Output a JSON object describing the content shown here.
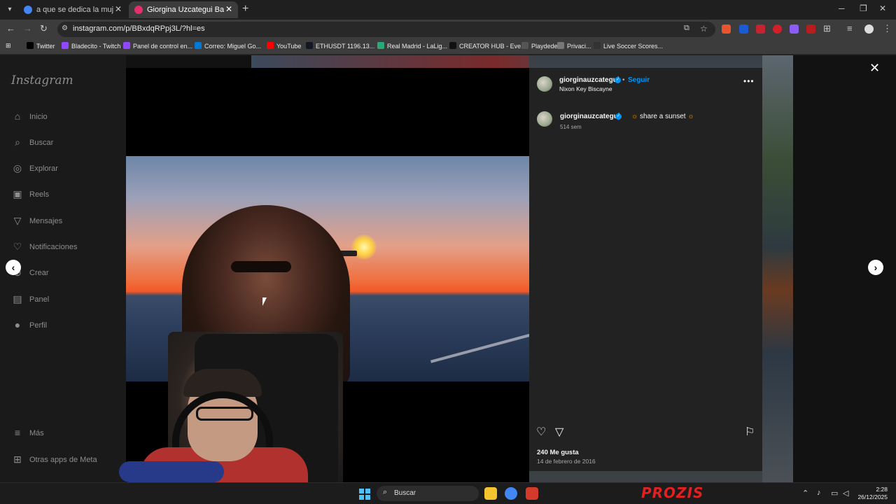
{
  "browser": {
    "tabs": [
      {
        "title": "a que se dedica la mujer de Ilia",
        "favicon_color": "#4285f4"
      },
      {
        "title": "Giorgina Uzcategui Badell (@gi",
        "favicon_color": "#e1306c"
      }
    ],
    "url": "instagram.com/p/BBxdqRPpj3L/?hl=es",
    "bookmarks": [
      {
        "label": "Twitter",
        "icon_color": "#000000"
      },
      {
        "label": "Bladecito - Twitch",
        "icon_color": "#9146ff"
      },
      {
        "label": "Panel de control en...",
        "icon_color": "#9146ff"
      },
      {
        "label": "Correo: Miguel Go...",
        "icon_color": "#0078d4"
      },
      {
        "label": "YouTube",
        "icon_color": "#ff0000"
      },
      {
        "label": "ETHUSDT 1196.13...",
        "icon_color": "#131722"
      },
      {
        "label": "Real Madrid - LaLig...",
        "icon_color": "#2aa876"
      },
      {
        "label": "CREATOR HUB - Eve...",
        "icon_color": "#111111"
      },
      {
        "label": "Playdede",
        "icon_color": "#555555"
      },
      {
        "label": "Privaci...",
        "icon_color": "#777777"
      },
      {
        "label": "Live Soccer Scores...",
        "icon_color": "#333333"
      }
    ]
  },
  "instagram": {
    "logo": "Instagram",
    "nav": [
      {
        "label": "Inicio",
        "icon": "home-icon"
      },
      {
        "label": "Buscar",
        "icon": "search-icon"
      },
      {
        "label": "Explorar",
        "icon": "compass-icon"
      },
      {
        "label": "Reels",
        "icon": "reels-icon"
      },
      {
        "label": "Mensajes",
        "icon": "messages-icon"
      },
      {
        "label": "Notificaciones",
        "icon": "heart-icon"
      },
      {
        "label": "Crear",
        "icon": "plus-icon"
      },
      {
        "label": "Panel",
        "icon": "dashboard-icon"
      },
      {
        "label": "Perfil",
        "icon": "profile-icon"
      }
    ],
    "more": {
      "label": "Más",
      "icon": "menu-icon"
    },
    "meta": {
      "label": "Otras apps de Meta",
      "icon": "meta-apps-icon"
    },
    "post": {
      "username": "giorginauzcategui",
      "follow_label": "Seguir",
      "location": "Nixon Key Biscayne",
      "caption_user": "giorginauzcategui",
      "caption_text": "share a sunset",
      "time_ago": "514 sem",
      "likes": "240 Me gusta",
      "date": "14 de febrero de 2016"
    }
  },
  "taskbar": {
    "search_label": "Buscar",
    "ad_text": "PROZIS",
    "time": "2:28",
    "date": "26/12/2025"
  },
  "colors": {
    "accent": "#0095f6",
    "taskbar_accent": "#4cc2ff",
    "ad": "#e32020"
  }
}
